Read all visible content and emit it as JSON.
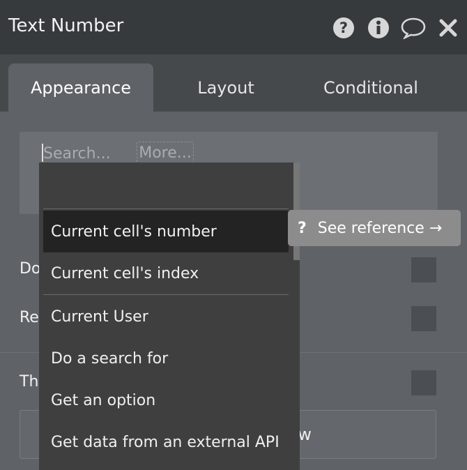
{
  "header": {
    "title": "Text Number",
    "icons": [
      "help-icon",
      "info-icon",
      "comment-icon",
      "close-icon"
    ]
  },
  "tabs": [
    {
      "label": "Appearance",
      "active": true
    },
    {
      "label": "Layout",
      "active": false
    },
    {
      "label": "Conditional",
      "active": false
    }
  ],
  "editor": {
    "search_placeholder": "Search...",
    "more_label": "More..."
  },
  "background_rows": {
    "row1_label": "Do",
    "row2_label": "Re",
    "row3_label": "Th",
    "button_partial_label": "w"
  },
  "dropdown": {
    "items": [
      {
        "label": "Current cell's number",
        "selected": true
      },
      {
        "label": "Current cell's index",
        "selected": false
      },
      {
        "label": "Current User",
        "selected": false
      },
      {
        "label": "Do a search for",
        "selected": false
      },
      {
        "label": "Get an option",
        "selected": false
      },
      {
        "label": "Get data from an external API",
        "selected": false
      }
    ]
  },
  "tooltip": {
    "icon_text": "?",
    "label": "See reference →"
  },
  "colors": {
    "header_bg": "#363a3d",
    "panel_bg": "#5f6266",
    "dropdown_bg": "#3f3f3f",
    "selected_item_bg": "#232323",
    "tooltip_bg": "#8c8c8c"
  }
}
